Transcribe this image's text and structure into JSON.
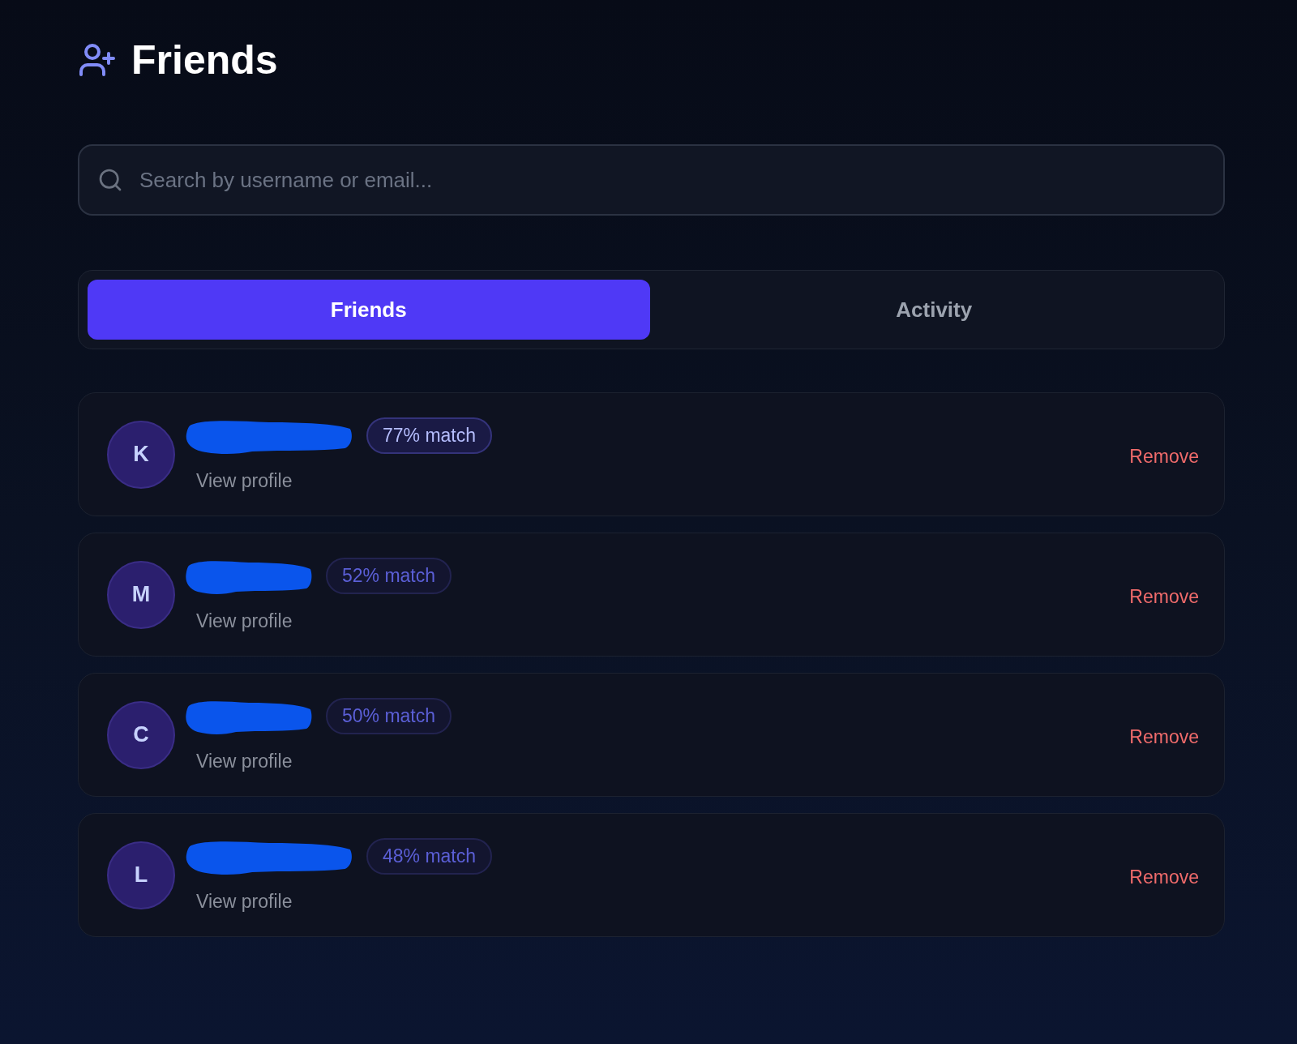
{
  "header": {
    "title": "Friends"
  },
  "search": {
    "placeholder": "Search by username or email..."
  },
  "tabs": [
    {
      "label": "Friends",
      "selected": true
    },
    {
      "label": "Activity",
      "selected": false
    }
  ],
  "friends": [
    {
      "initial": "K",
      "name_redacted": true,
      "kind": "long",
      "match": "77% match",
      "highlighted": true,
      "link": "View profile",
      "action": "Remove"
    },
    {
      "initial": "M",
      "name_redacted": true,
      "kind": "short",
      "match": "52% match",
      "highlighted": false,
      "link": "View profile",
      "action": "Remove"
    },
    {
      "initial": "C",
      "name_redacted": true,
      "kind": "short",
      "match": "50% match",
      "highlighted": false,
      "link": "View profile",
      "action": "Remove"
    },
    {
      "initial": "L",
      "name_redacted": true,
      "kind": "long",
      "match": "48% match",
      "highlighted": false,
      "link": "View profile",
      "action": "Remove"
    }
  ]
}
